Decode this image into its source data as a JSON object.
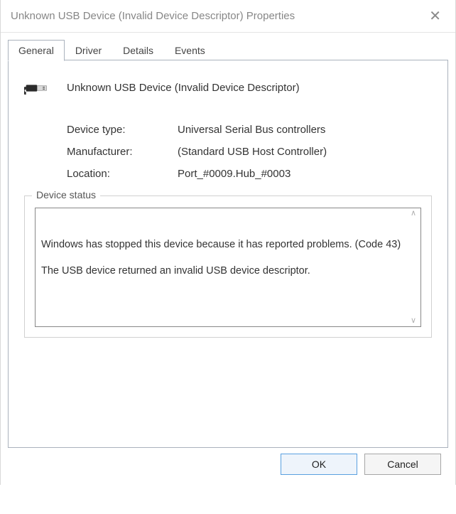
{
  "titlebar": {
    "title": "Unknown USB Device (Invalid Device Descriptor) Properties",
    "close_glyph": "✕"
  },
  "tabs": [
    {
      "label": "General",
      "active": true
    },
    {
      "label": "Driver",
      "active": false
    },
    {
      "label": "Details",
      "active": false
    },
    {
      "label": "Events",
      "active": false
    }
  ],
  "device": {
    "icon_name": "usb-plug-icon",
    "name": "Unknown USB Device (Invalid Device Descriptor)",
    "type_label": "Device type:",
    "type_value": "Universal Serial Bus controllers",
    "manufacturer_label": "Manufacturer:",
    "manufacturer_value": "(Standard USB Host Controller)",
    "location_label": "Location:",
    "location_value": "Port_#0009.Hub_#0003"
  },
  "status_group": {
    "legend": "Device status",
    "text": "Windows has stopped this device because it has reported problems. (Code 43)\n\nThe USB device returned an invalid USB device descriptor."
  },
  "footer": {
    "ok_label": "OK",
    "cancel_label": "Cancel"
  }
}
